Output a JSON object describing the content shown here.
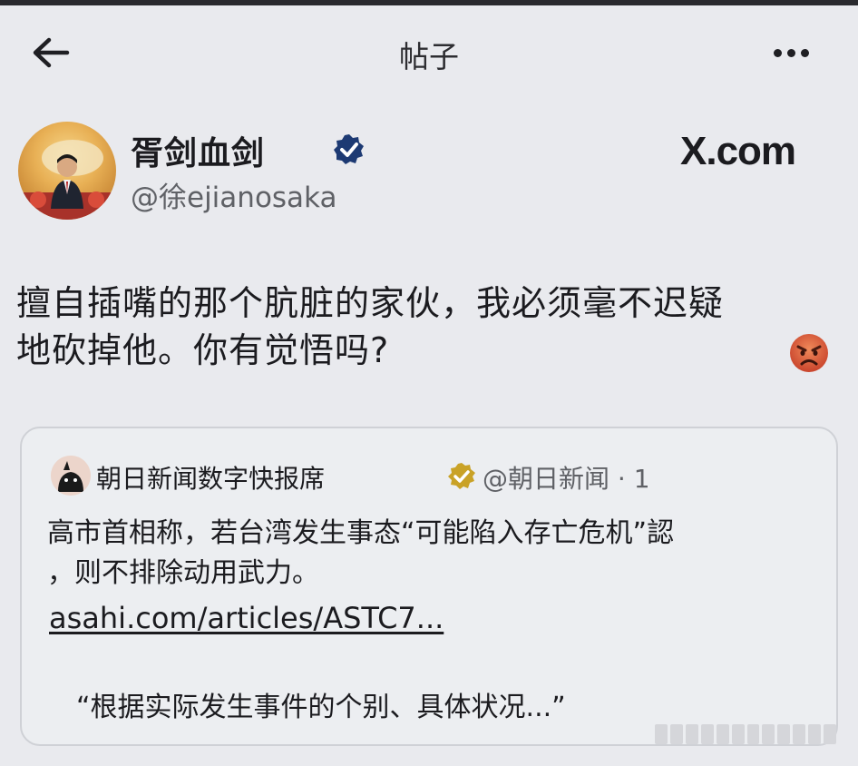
{
  "nav": {
    "title": "帖子",
    "back_icon": "back-arrow-icon",
    "more_icon": "more-dots-icon"
  },
  "author": {
    "name": "胥剑血剑",
    "handle": "@徐ejianosaka",
    "verified": true,
    "verified_color": "#1d3a73"
  },
  "source_brand": "X.com",
  "post": {
    "text_line1": "擅自插嘴的那个肮脏的家伙，我必须毫不迟疑",
    "text_line2": "地砍掉他。你有觉悟吗?",
    "emoji": "angry-face-emoji"
  },
  "quote": {
    "name": "朝日新闻数字快报席",
    "verified_color": "#c9a227",
    "handle": "@朝日新闻 · 1",
    "text_line1": "高市首相称，若台湾发生事态“可能陷入存亡危机”認",
    "text_line2": "，则不排除动用武力。",
    "link": "asahi.com/articles/ASTC7...",
    "excerpt": "“根据实际发生事件的个别、具体状况...”"
  },
  "colors": {
    "background": "#e9eaee",
    "text": "#1b1b1f",
    "secondary": "#5f6166",
    "card_border": "#cfd1d6"
  }
}
